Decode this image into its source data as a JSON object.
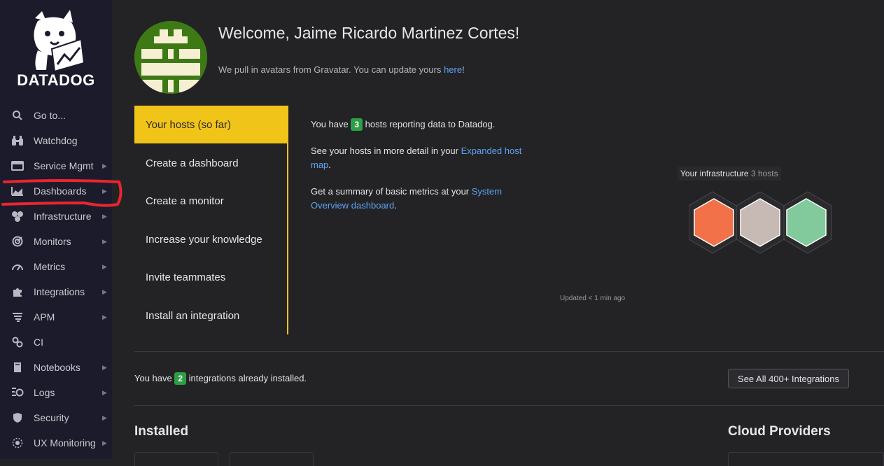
{
  "brand": {
    "name": "DATADOG"
  },
  "sidebar": {
    "items": [
      {
        "label": "Go to...",
        "icon": "search-icon",
        "has_caret": false
      },
      {
        "label": "Watchdog",
        "icon": "binoculars-icon",
        "has_caret": false
      },
      {
        "label": "Service Mgmt",
        "icon": "service-mgmt-icon",
        "has_caret": true
      },
      {
        "label": "Dashboards",
        "icon": "dashboards-icon",
        "has_caret": true
      },
      {
        "label": "Infrastructure",
        "icon": "infrastructure-icon",
        "has_caret": true
      },
      {
        "label": "Monitors",
        "icon": "monitors-icon",
        "has_caret": true
      },
      {
        "label": "Metrics",
        "icon": "metrics-icon",
        "has_caret": true
      },
      {
        "label": "Integrations",
        "icon": "puzzle-icon",
        "has_caret": true
      },
      {
        "label": "APM",
        "icon": "apm-icon",
        "has_caret": true
      },
      {
        "label": "CI",
        "icon": "ci-icon",
        "has_caret": false
      },
      {
        "label": "Notebooks",
        "icon": "notebook-icon",
        "has_caret": true
      },
      {
        "label": "Logs",
        "icon": "logs-icon",
        "has_caret": true
      },
      {
        "label": "Security",
        "icon": "shield-icon",
        "has_caret": true
      },
      {
        "label": "UX Monitoring",
        "icon": "ux-monitoring-icon",
        "has_caret": true
      }
    ]
  },
  "welcome": {
    "title": "Welcome, Jaime Ricardo Martinez Cortes!",
    "gravatar_text": "We pull in avatars from Gravatar. You can update yours ",
    "gravatar_link": "here",
    "gravatar_end": "!"
  },
  "tabs": [
    {
      "label": "Your hosts (so far)",
      "active": true
    },
    {
      "label": "Create a dashboard",
      "active": false
    },
    {
      "label": "Create a monitor",
      "active": false
    },
    {
      "label": "Increase your knowledge",
      "active": false
    },
    {
      "label": "Invite teammates",
      "active": false
    },
    {
      "label": "Install an integration",
      "active": false
    }
  ],
  "hosts": {
    "p1_pre": "You have ",
    "count": "3",
    "p1_post": " hosts reporting data to Datadog.",
    "p2_pre": "See your hosts in more detail in your ",
    "p2_link": "Expanded host map",
    "p2_post": ".",
    "p3_pre": "Get a summary of basic metrics at your ",
    "p3_link": "System Overview dashboard",
    "p3_post": "."
  },
  "infrastructure": {
    "label": "Your infrastructure",
    "count_text": "3 hosts",
    "hex_colors": [
      "#f27149",
      "#c7b9b3",
      "#82c99c"
    ],
    "updated": "Updated < 1 min ago"
  },
  "integrations": {
    "pre": "You have ",
    "count": "2",
    "post": " integrations already installed.",
    "button": "See All 400+ Integrations"
  },
  "sections": {
    "installed": "Installed",
    "cloud": "Cloud Providers"
  },
  "colors": {
    "accent": "#f0c419",
    "link": "#5ea2f5",
    "badge": "#2d9e45",
    "annotation": "#e8262f"
  }
}
